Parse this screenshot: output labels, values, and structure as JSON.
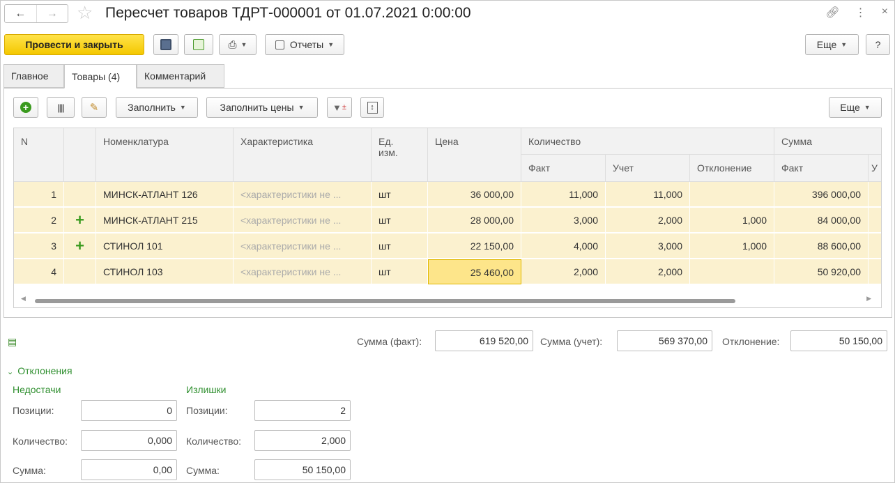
{
  "window": {
    "title": "Пересчет товаров ТДРТ-000001 от 01.07.2021 0:00:00",
    "link_icon": "link-icon",
    "menu_icon": "more-vert-icon",
    "close_icon": "close-icon"
  },
  "toolbar": {
    "post_close_label": "Провести и закрыть",
    "reports_label": "Отчеты",
    "more_label": "Еще",
    "help_label": "?"
  },
  "tabs": [
    {
      "label": "Главное"
    },
    {
      "label": "Товары (4)"
    },
    {
      "label": "Комментарий"
    }
  ],
  "table_toolbar": {
    "fill_label": "Заполнить",
    "fill_prices_label": "Заполнить цены",
    "more_label": "Еще"
  },
  "table": {
    "headers": {
      "n": "N",
      "nomenclature": "Номенклатура",
      "characteristic": "Характеристика",
      "unit": "Ед. изм.",
      "price": "Цена",
      "quantity": "Количество",
      "qty_fact": "Факт",
      "qty_account": "Учет",
      "qty_deviation": "Отклонение",
      "sum": "Сумма",
      "sum_fact": "Факт",
      "sum_account_partial": "У"
    },
    "rows": [
      {
        "n": "1",
        "mark": "",
        "name": "МИНСК-АТЛАНТ 126",
        "char": "<характеристики не ...",
        "unit": "шт",
        "price": "36 000,00",
        "fact": "11,000",
        "account": "11,000",
        "deviation": "",
        "sum": "396 000,00"
      },
      {
        "n": "2",
        "mark": "+",
        "name": "МИНСК-АТЛАНТ 215",
        "char": "<характеристики не ...",
        "unit": "шт",
        "price": "28 000,00",
        "fact": "3,000",
        "account": "2,000",
        "deviation": "1,000",
        "sum": "84 000,00"
      },
      {
        "n": "3",
        "mark": "+",
        "name": "СТИНОЛ 101",
        "char": "<характеристики не ...",
        "unit": "шт",
        "price": "22 150,00",
        "fact": "4,000",
        "account": "3,000",
        "deviation": "1,000",
        "sum": "88 600,00"
      },
      {
        "n": "4",
        "mark": "",
        "name": "СТИНОЛ 103",
        "char": "<характеристики не ...",
        "unit": "шт",
        "price": "25 460,00",
        "fact": "2,000",
        "account": "2,000",
        "deviation": "",
        "sum": "50 920,00"
      }
    ]
  },
  "totals": {
    "sum_fact_label": "Сумма (факт):",
    "sum_fact": "619 520,00",
    "sum_account_label": "Сумма (учет):",
    "sum_account": "569 370,00",
    "deviation_label": "Отклонение:",
    "deviation": "50 150,00"
  },
  "deviations": {
    "section_label": "Отклонения",
    "shortages": {
      "title": "Недостачи",
      "positions_label": "Позиции:",
      "positions": "0",
      "quantity_label": "Количество:",
      "quantity": "0,000",
      "sum_label": "Сумма:",
      "sum": "0,00"
    },
    "surpluses": {
      "title": "Излишки",
      "positions_label": "Позиции:",
      "positions": "2",
      "quantity_label": "Количество:",
      "quantity": "2,000",
      "sum_label": "Сумма:",
      "sum": "50 150,00"
    }
  },
  "colors": {
    "accent_yellow": "#f4c800",
    "row_highlight": "#fbf1cf",
    "green": "#2f8f2f"
  }
}
